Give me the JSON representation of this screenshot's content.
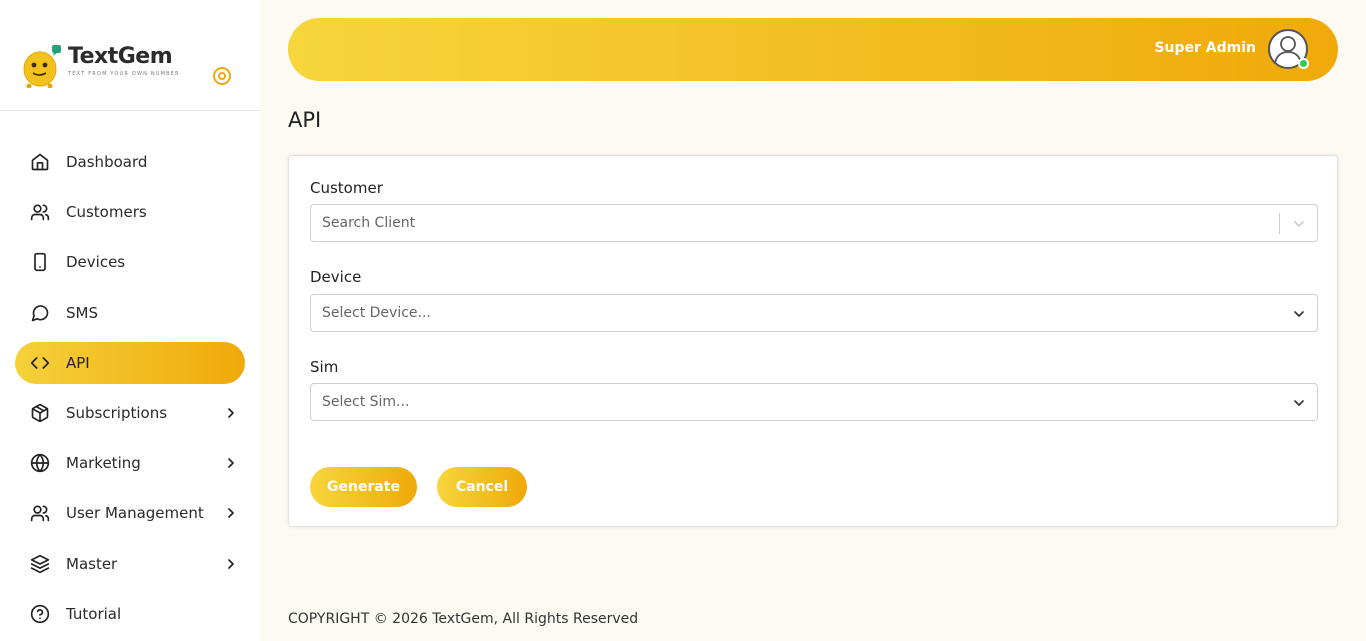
{
  "brand": {
    "name": "TextGem",
    "tagline": "TEXT FROM YOUR OWN NUMBER",
    "accent": "#f0a90a"
  },
  "sidebar": {
    "items": [
      {
        "label": "Dashboard",
        "icon": "home-icon",
        "active": false,
        "has_submenu": false
      },
      {
        "label": "Customers",
        "icon": "users-icon",
        "active": false,
        "has_submenu": false
      },
      {
        "label": "Devices",
        "icon": "smartphone-icon",
        "active": false,
        "has_submenu": false
      },
      {
        "label": "SMS",
        "icon": "message-circle-icon",
        "active": false,
        "has_submenu": false
      },
      {
        "label": "API",
        "icon": "code-icon",
        "active": true,
        "has_submenu": false
      },
      {
        "label": "Subscriptions",
        "icon": "package-icon",
        "active": false,
        "has_submenu": true
      },
      {
        "label": "Marketing",
        "icon": "globe-icon",
        "active": false,
        "has_submenu": true
      },
      {
        "label": "User Management",
        "icon": "users-icon",
        "active": false,
        "has_submenu": true
      },
      {
        "label": "Master",
        "icon": "layers-icon",
        "active": false,
        "has_submenu": true
      },
      {
        "label": "Tutorial",
        "icon": "help-circle-icon",
        "active": false,
        "has_submenu": false
      }
    ]
  },
  "header": {
    "user_name": "Super Admin",
    "status_color": "#2ecc55"
  },
  "page": {
    "title": "API"
  },
  "form": {
    "customer": {
      "label": "Customer",
      "placeholder": "Search Client"
    },
    "device": {
      "label": "Device",
      "placeholder": "Select Device..."
    },
    "sim": {
      "label": "Sim",
      "placeholder": "Select Sim..."
    },
    "generate_label": "Generate",
    "cancel_label": "Cancel"
  },
  "footer": {
    "text": "COPYRIGHT © 2026 TextGem, All Rights Reserved"
  }
}
